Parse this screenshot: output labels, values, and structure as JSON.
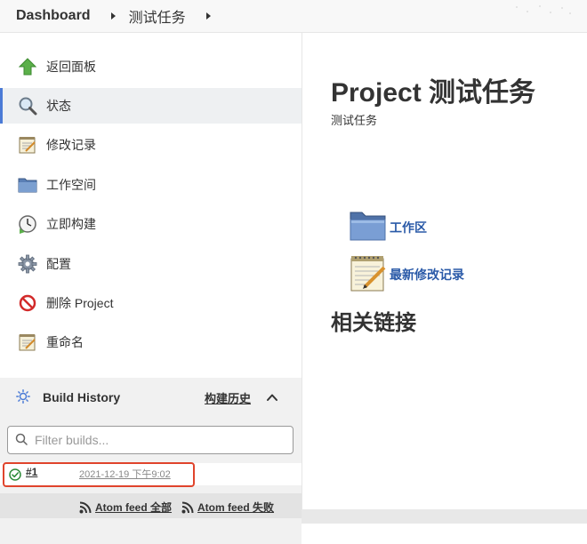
{
  "breadcrumb": {
    "items": [
      "Dashboard",
      "测试任务"
    ]
  },
  "sidebar": {
    "items": [
      {
        "label": "返回面板",
        "icon": "up-arrow-icon"
      },
      {
        "label": "状态",
        "icon": "magnifier-icon"
      },
      {
        "label": "修改记录",
        "icon": "notepad-icon"
      },
      {
        "label": "工作空间",
        "icon": "folder-icon"
      },
      {
        "label": "立即构建",
        "icon": "build-clock-icon"
      },
      {
        "label": "配置",
        "icon": "gear-icon"
      },
      {
        "label": "删除 Project",
        "icon": "no-entry-icon"
      },
      {
        "label": "重命名",
        "icon": "notepad-icon"
      }
    ],
    "active_index": 1
  },
  "build_history": {
    "title": "Build History",
    "trend_link": "构建历史",
    "filter_placeholder": "Filter builds...",
    "builds": [
      {
        "number": "#1",
        "date": "2021-12-19 下午9:02",
        "status": "success"
      }
    ],
    "feeds": {
      "all": "Atom feed 全部",
      "failed": "Atom feed 失败"
    }
  },
  "main": {
    "title": "Project 测试任务",
    "description": "测试任务",
    "links": [
      {
        "label": "工作区",
        "icon": "folder-icon"
      },
      {
        "label": "最新修改记录",
        "icon": "notepad-icon"
      }
    ],
    "section_title": "相关链接"
  },
  "colors": {
    "accent": "#4b7bd6",
    "link": "#2a5aa8",
    "highlight": "#e0442c",
    "success": "#2e8b3a"
  }
}
